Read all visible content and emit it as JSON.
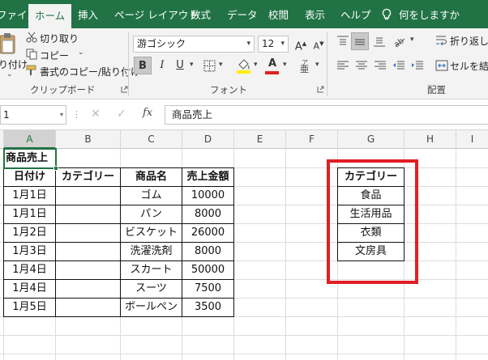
{
  "tabs": [
    {
      "label": "ファイル",
      "active": false
    },
    {
      "label": "ホーム",
      "active": true
    },
    {
      "label": "挿入",
      "active": false
    },
    {
      "label": "ページ レイアウト",
      "active": false
    },
    {
      "label": "数式",
      "active": false
    },
    {
      "label": "データ",
      "active": false
    },
    {
      "label": "校閲",
      "active": false
    },
    {
      "label": "表示",
      "active": false
    },
    {
      "label": "ヘルプ",
      "active": false
    },
    {
      "label": "何をしますか",
      "active": false
    }
  ],
  "ribbon": {
    "clipboard": {
      "paste_label": "り付け",
      "cut_label": "切り取り",
      "copy_label": "コピー",
      "format_painter_label": "書式のコピー/貼り付け",
      "group_label": "クリップボード"
    },
    "font": {
      "font_name": "游ゴシック",
      "font_size": "12",
      "bold_label": "B",
      "italic_label": "I",
      "underline_label": "U",
      "grow_label": "A",
      "shrink_label": "A",
      "font_color_label": "A",
      "group_label": "フォント"
    },
    "alignment": {
      "wrap_text_label": "折り返して全",
      "merge_label": "セルを結合し",
      "group_label": "配置"
    }
  },
  "formula_bar": {
    "name_box": "1",
    "fx_label": "fx",
    "formula": "商品売上"
  },
  "columns": [
    "A",
    "B",
    "C",
    "D",
    "E",
    "F",
    "G",
    "H",
    "I"
  ],
  "sheet": {
    "title": "商品売上",
    "headers": [
      "日付け",
      "カテゴリー",
      "商品名",
      "売上金額"
    ],
    "rows": [
      [
        "1月1日",
        "",
        "ゴム",
        "10000"
      ],
      [
        "1月1日",
        "",
        "パン",
        "8000"
      ],
      [
        "1月2日",
        "",
        "ビスケット",
        "26000"
      ],
      [
        "1月3日",
        "",
        "洗濯洗剤",
        "8000"
      ],
      [
        "1月4日",
        "",
        "スカート",
        "50000"
      ],
      [
        "1月4日",
        "",
        "スーツ",
        "7500"
      ],
      [
        "1月5日",
        "",
        "ボールペン",
        "3500"
      ]
    ],
    "category_header": "カテゴリー",
    "categories": [
      "食品",
      "生活用品",
      "衣類",
      "文房具"
    ]
  },
  "colors": {
    "accent": "#217346",
    "highlight_box": "#e01f25"
  }
}
